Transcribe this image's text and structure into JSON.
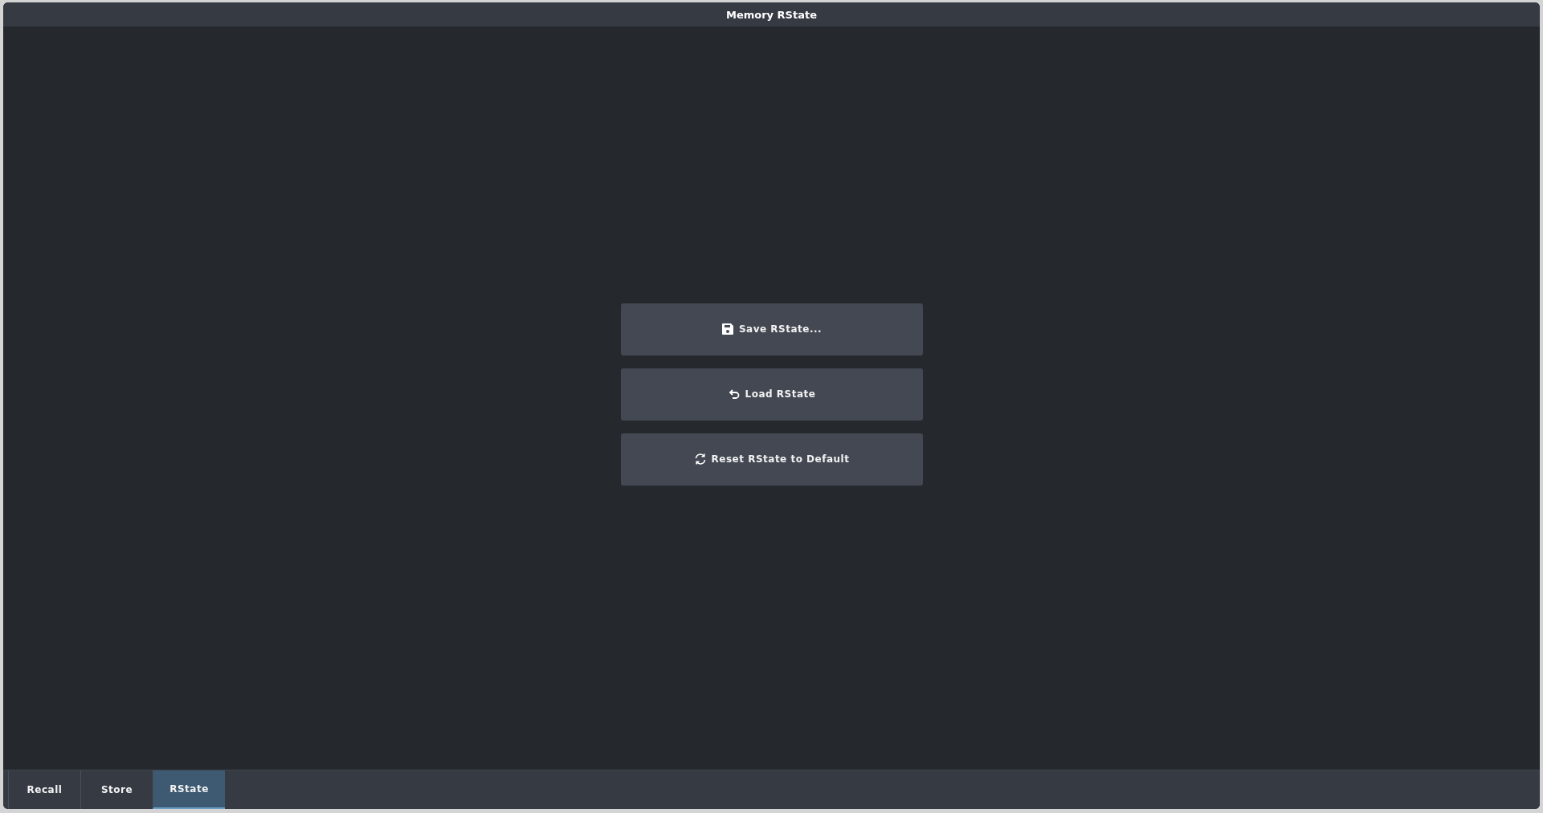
{
  "window": {
    "title": "Memory RState"
  },
  "buttons": [
    {
      "label": "Save RState...",
      "kind": "save"
    },
    {
      "label": "Load RState",
      "kind": "load"
    },
    {
      "label": "Reset RState to Default",
      "kind": "reset"
    }
  ],
  "tabs": [
    {
      "label": "Recall",
      "selected": false
    },
    {
      "label": "Store",
      "selected": false
    },
    {
      "label": "RState",
      "selected": true
    }
  ]
}
